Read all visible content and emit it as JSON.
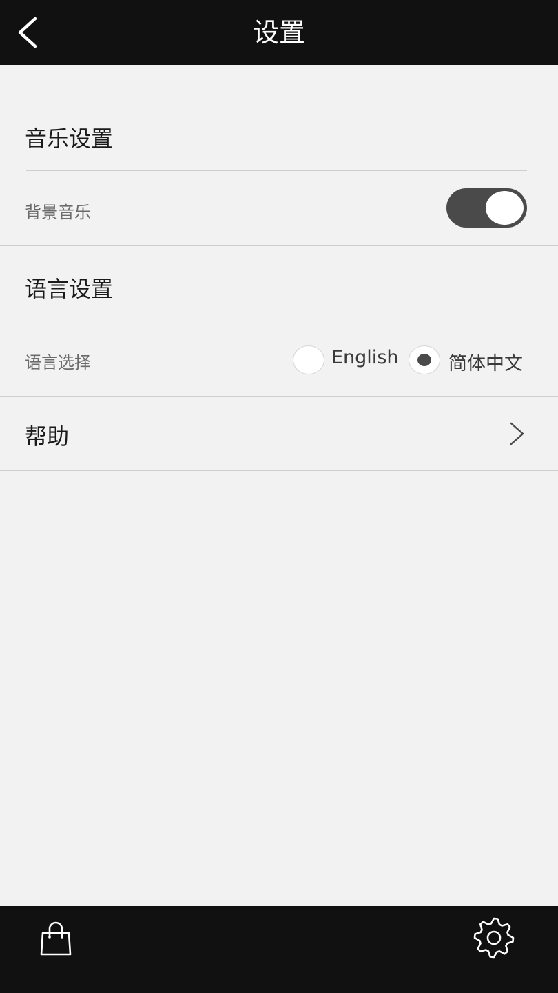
{
  "header": {
    "title": "设置",
    "back_icon": "chevron-left-icon"
  },
  "music_settings": {
    "section_title": "音乐设置",
    "background_music": {
      "label": "背景音乐",
      "enabled": true
    }
  },
  "language_settings": {
    "section_title": "语言设置",
    "selector": {
      "label": "语言选择",
      "options": [
        {
          "label": "English",
          "selected": false
        },
        {
          "label": "简体中文",
          "selected": true
        }
      ]
    }
  },
  "help": {
    "label": "帮助",
    "icon": "chevron-right-icon"
  },
  "bottom_nav": {
    "left_icon": "shopping-bag-icon",
    "right_icon": "gear-icon"
  },
  "colors": {
    "bar_background": "#111111",
    "page_background": "#f2f2f2",
    "toggle_on": "#4a4a4a",
    "divider": "#cfcfcf"
  }
}
